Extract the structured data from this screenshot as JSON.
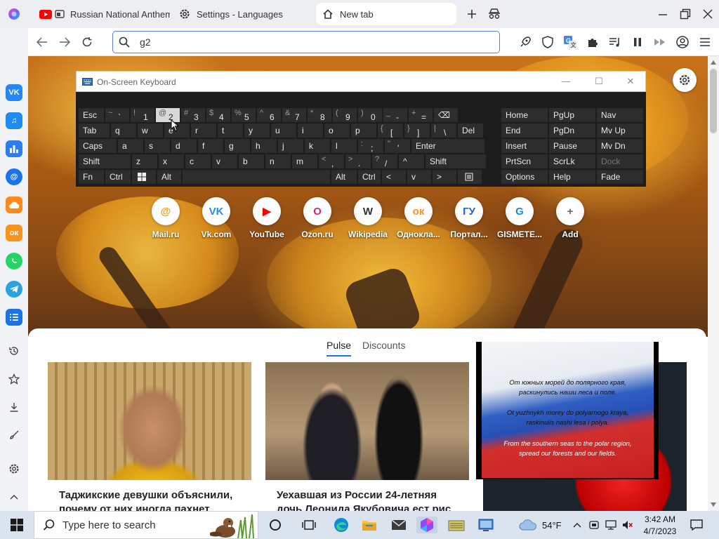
{
  "browser": {
    "tabs": [
      {
        "label": "Russian National Anthem",
        "icon": "youtube-icon"
      },
      {
        "label": "Settings - Languages",
        "icon": "gear-icon"
      },
      {
        "label": "New tab",
        "icon": "home-icon",
        "active": true
      }
    ],
    "address": {
      "value": "g2"
    }
  },
  "keyboard": {
    "title": "On-Screen Keyboard",
    "rows": [
      [
        {
          "m": "Esc"
        },
        {
          "s": "~",
          "m": "`"
        },
        {
          "s": "!",
          "m": "1"
        },
        {
          "s": "@",
          "m": "2",
          "hi": true
        },
        {
          "s": "#",
          "m": "3"
        },
        {
          "s": "$",
          "m": "4"
        },
        {
          "s": "%",
          "m": "5"
        },
        {
          "s": "^",
          "m": "6"
        },
        {
          "s": "&",
          "m": "7"
        },
        {
          "s": "*",
          "m": "8"
        },
        {
          "s": "(",
          "m": "9"
        },
        {
          "s": ")",
          "m": "0"
        },
        {
          "s": "_",
          "m": "-"
        },
        {
          "s": "+",
          "m": "="
        },
        {
          "m": "⌫"
        }
      ],
      [
        {
          "m": "Tab"
        },
        {
          "m": "q"
        },
        {
          "m": "w"
        },
        {
          "m": "e"
        },
        {
          "m": "r"
        },
        {
          "m": "t"
        },
        {
          "m": "y"
        },
        {
          "m": "u"
        },
        {
          "m": "i"
        },
        {
          "m": "o"
        },
        {
          "m": "p"
        },
        {
          "s": "{",
          "m": "["
        },
        {
          "s": "}",
          "m": "]"
        },
        {
          "s": "|",
          "m": "\\"
        },
        {
          "m": "Del"
        }
      ],
      [
        {
          "m": "Caps"
        },
        {
          "m": "a"
        },
        {
          "m": "s"
        },
        {
          "m": "d"
        },
        {
          "m": "f"
        },
        {
          "m": "g"
        },
        {
          "m": "h"
        },
        {
          "m": "j"
        },
        {
          "m": "k"
        },
        {
          "m": "l"
        },
        {
          "s": ":",
          "m": ";"
        },
        {
          "s": "\"",
          "m": "'"
        },
        {
          "m": "Enter"
        }
      ],
      [
        {
          "m": "Shift"
        },
        {
          "m": "z"
        },
        {
          "m": "x"
        },
        {
          "m": "c"
        },
        {
          "m": "v"
        },
        {
          "m": "b"
        },
        {
          "m": "n"
        },
        {
          "m": "m"
        },
        {
          "s": "<",
          "m": ","
        },
        {
          "s": ">",
          "m": "."
        },
        {
          "s": "?",
          "m": "/"
        },
        {
          "m": "^"
        },
        {
          "m": "Shift"
        }
      ],
      [
        {
          "m": "Fn"
        },
        {
          "m": "Ctrl"
        },
        {
          "m": "win"
        },
        {
          "m": "Alt"
        },
        {
          "m": ""
        },
        {
          "m": "Alt"
        },
        {
          "m": "Ctrl"
        },
        {
          "m": "<"
        },
        {
          "m": "v"
        },
        {
          "m": ">"
        },
        {
          "m": "menu"
        }
      ]
    ],
    "nav": [
      [
        "Home",
        "PgUp",
        "Nav"
      ],
      [
        "End",
        "PgDn",
        "Mv Up"
      ],
      [
        "Insert",
        "Pause",
        "Mv Dn"
      ],
      [
        "PrtScn",
        "ScrLk",
        "Dock"
      ],
      [
        "Options",
        "Help",
        "Fade"
      ]
    ]
  },
  "speed_dial": [
    {
      "label": "Mail.ru",
      "icon": "mailru-icon",
      "color": "#f39a1f"
    },
    {
      "label": "Vk.com",
      "icon": "vk-icon",
      "color": "#2787f5"
    },
    {
      "label": "YouTube",
      "icon": "youtube-icon",
      "color": "#ff0000"
    },
    {
      "label": "Ozon.ru",
      "icon": "ozon-icon",
      "color": "#e0245e"
    },
    {
      "label": "Wikipedia",
      "icon": "wikipedia-icon",
      "color": "#333333"
    },
    {
      "label": "Однокла...",
      "icon": "odnoklassniki-icon",
      "color": "#f7931e"
    },
    {
      "label": "Портал...",
      "icon": "gosuslugi-icon",
      "color": "#2d5bd3"
    },
    {
      "label": "GISMETE...",
      "icon": "gismeteo-icon",
      "color": "#1e88e5"
    },
    {
      "label": "Add",
      "icon": "plus-icon",
      "color": "#666666"
    }
  ],
  "feed": {
    "tabs": [
      "Pulse",
      "Discounts"
    ],
    "active_tab": "Pulse",
    "cards": [
      {
        "title": "Таджикские девушки объяснили, почему от них иногда пахнет"
      },
      {
        "title": "Уехавшая из России 24-летняя дочь Леонида Якубовича ест рис"
      }
    ]
  },
  "anthem_overlay": {
    "lines": [
      "От южных морей до полярного края,",
      "раскинулись наши леса и поля.",
      "Ot yuzhnykh morey do polyarnogo kraya,",
      "raskinulis nashi lesa i polya.",
      "From the southern seas to the polar region,",
      "spread our forests and our fields."
    ]
  },
  "taskbar": {
    "search_placeholder": "Type here to search",
    "weather": "54°F",
    "time": "3:42 AM",
    "date": "4/7/2023"
  }
}
